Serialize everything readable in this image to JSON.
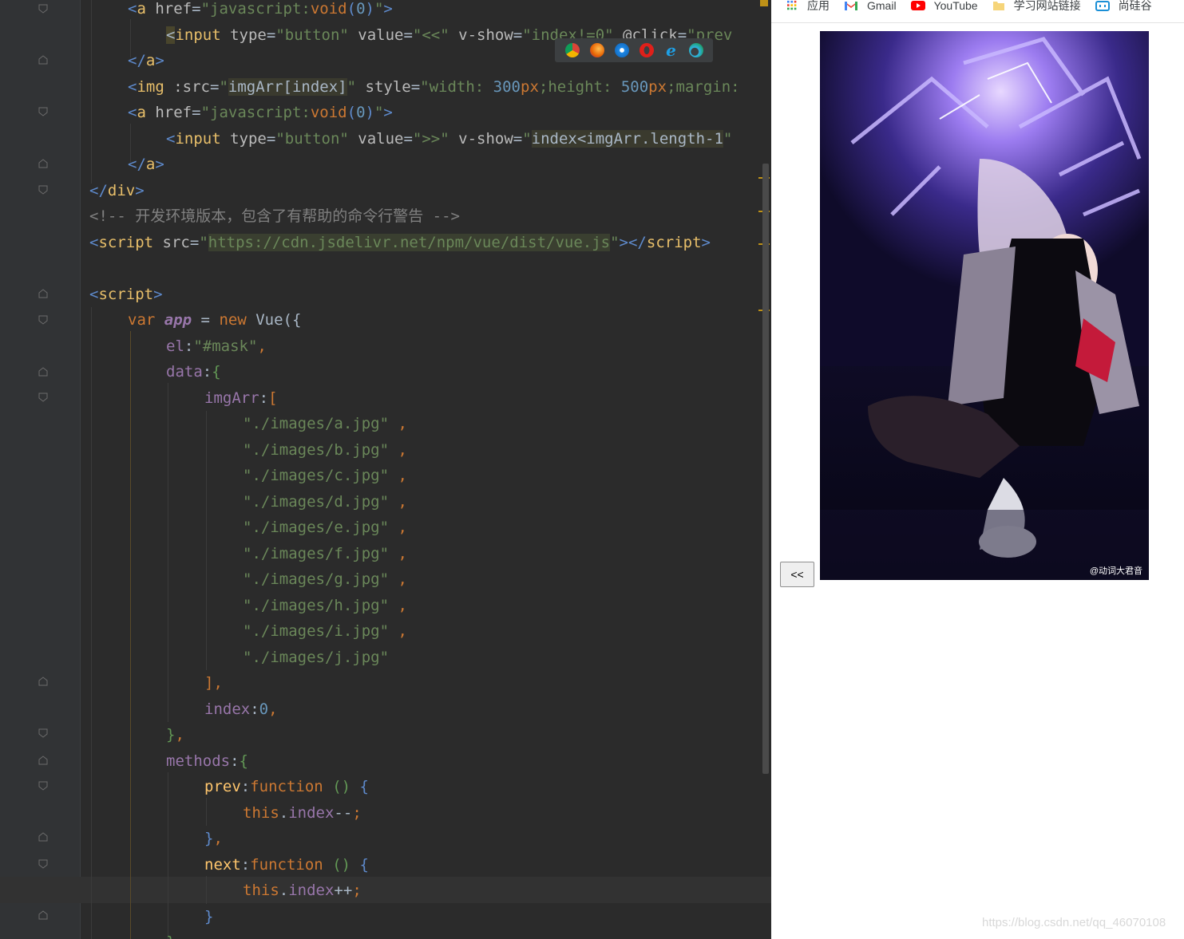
{
  "editor": {
    "lines": [
      {
        "tokens": [
          [
            "brk",
            "<"
          ],
          [
            "tag",
            "a"
          ],
          [
            "attr",
            " href"
          ],
          [
            "plain",
            "="
          ],
          [
            "str",
            "\"javascript:"
          ],
          [
            "kw",
            "void"
          ],
          [
            "brk",
            "("
          ],
          [
            "num",
            "0"
          ],
          [
            "brk",
            ")"
          ],
          [
            "str",
            "\""
          ],
          [
            "brk",
            ">"
          ]
        ]
      },
      {
        "tokens": [
          [
            "hlbg",
            "<"
          ],
          [
            "tag",
            "input"
          ],
          [
            "attr",
            " type"
          ],
          [
            "plain",
            "="
          ],
          [
            "str",
            "\"button\""
          ],
          [
            "attr",
            " value"
          ],
          [
            "plain",
            "="
          ],
          [
            "str",
            "\"<<\""
          ],
          [
            "attr",
            " v-show"
          ],
          [
            "plain",
            "="
          ],
          [
            "str",
            "\"index!=0\""
          ],
          [
            "attr",
            " @click"
          ],
          [
            "plain",
            "="
          ],
          [
            "str",
            "\"prev"
          ]
        ]
      },
      {
        "tokens": [
          [
            "brk",
            "</"
          ],
          [
            "tag",
            "a"
          ],
          [
            "brk",
            ">"
          ]
        ]
      },
      {
        "tokens": [
          [
            "brk",
            "<"
          ],
          [
            "tag",
            "img"
          ],
          [
            "attr",
            " :src"
          ],
          [
            "plain",
            "="
          ],
          [
            "str",
            "\""
          ],
          [
            "js",
            "imgArr[index]"
          ],
          [
            "str",
            "\""
          ],
          [
            "attr",
            " style"
          ],
          [
            "plain",
            "="
          ],
          [
            "str",
            "\"width: "
          ],
          [
            "num",
            "300"
          ],
          [
            "kw",
            "px"
          ],
          [
            "str",
            ";height: "
          ],
          [
            "num",
            "500"
          ],
          [
            "kw",
            "px"
          ],
          [
            "str",
            ";margin:"
          ]
        ]
      },
      {
        "tokens": [
          [
            "brk",
            "<"
          ],
          [
            "tag",
            "a"
          ],
          [
            "attr",
            " href"
          ],
          [
            "plain",
            "="
          ],
          [
            "str",
            "\"javascript:"
          ],
          [
            "kw",
            "void"
          ],
          [
            "brk",
            "("
          ],
          [
            "num",
            "0"
          ],
          [
            "brk",
            ")"
          ],
          [
            "str",
            "\""
          ],
          [
            "brk",
            ">"
          ]
        ]
      },
      {
        "tokens": [
          [
            "brk",
            "<"
          ],
          [
            "tag",
            "input"
          ],
          [
            "attr",
            " type"
          ],
          [
            "plain",
            "="
          ],
          [
            "str",
            "\"button\""
          ],
          [
            "attr",
            " value"
          ],
          [
            "plain",
            "="
          ],
          [
            "str",
            "\">>\""
          ],
          [
            "attr",
            " v-show"
          ],
          [
            "plain",
            "="
          ],
          [
            "str",
            "\""
          ],
          [
            "js",
            "index<imgArr.length-1"
          ],
          [
            "str",
            "\""
          ]
        ]
      },
      {
        "tokens": [
          [
            "brk",
            "</"
          ],
          [
            "tag",
            "a"
          ],
          [
            "brk",
            ">"
          ]
        ]
      },
      {
        "tokens": [
          [
            "brk",
            "</"
          ],
          [
            "tag",
            "div"
          ],
          [
            "brk",
            ">"
          ]
        ]
      },
      {
        "tokens": [
          [
            "cmt",
            "<!-- 开发环境版本，包含了有帮助的命令行警告 -->"
          ]
        ]
      },
      {
        "tokens": [
          [
            "brk",
            "<"
          ],
          [
            "tag",
            "script"
          ],
          [
            "attr",
            " src"
          ],
          [
            "plain",
            "="
          ],
          [
            "str",
            "\""
          ],
          [
            "strhl",
            "https://cdn.jsdelivr.net/npm/vue/dist/vue.js"
          ],
          [
            "str",
            "\""
          ],
          [
            "brk",
            "></"
          ],
          [
            "tag",
            "script"
          ],
          [
            "brk",
            ">"
          ]
        ]
      },
      {
        "tokens": []
      },
      {
        "tokens": [
          [
            "brk",
            "<"
          ],
          [
            "tag",
            "script"
          ],
          [
            "brk",
            ">"
          ]
        ]
      },
      {
        "tokens": [
          [
            "kw",
            "var"
          ],
          [
            "plain",
            " "
          ],
          [
            "ital",
            "app"
          ],
          [
            "plain",
            " = "
          ],
          [
            "kw",
            "new"
          ],
          [
            "plain",
            " Vue({"
          ]
        ]
      },
      {
        "tokens": [
          [
            "fld",
            "el"
          ],
          [
            "plain",
            ":"
          ],
          [
            "str",
            "\"#mask\""
          ],
          [
            "kw",
            ","
          ]
        ]
      },
      {
        "tokens": [
          [
            "fld",
            "data"
          ],
          [
            "plain",
            ":"
          ],
          [
            "green",
            "{"
          ]
        ]
      },
      {
        "tokens": [
          [
            "fld",
            "imgArr"
          ],
          [
            "plain",
            ":"
          ],
          [
            "kw",
            "["
          ]
        ]
      },
      {
        "tokens": [
          [
            "str",
            "\"./images/a.jpg\""
          ],
          [
            "kw",
            " ,"
          ]
        ]
      },
      {
        "tokens": [
          [
            "str",
            "\"./images/b.jpg\""
          ],
          [
            "kw",
            " ,"
          ]
        ]
      },
      {
        "tokens": [
          [
            "str",
            "\"./images/c.jpg\""
          ],
          [
            "kw",
            " ,"
          ]
        ]
      },
      {
        "tokens": [
          [
            "str",
            "\"./images/d.jpg\""
          ],
          [
            "kw",
            " ,"
          ]
        ]
      },
      {
        "tokens": [
          [
            "str",
            "\"./images/e.jpg\""
          ],
          [
            "kw",
            " ,"
          ]
        ]
      },
      {
        "tokens": [
          [
            "str",
            "\"./images/f.jpg\""
          ],
          [
            "kw",
            " ,"
          ]
        ]
      },
      {
        "tokens": [
          [
            "str",
            "\"./images/g.jpg\""
          ],
          [
            "kw",
            " ,"
          ]
        ]
      },
      {
        "tokens": [
          [
            "str",
            "\"./images/h.jpg\""
          ],
          [
            "kw",
            " ,"
          ]
        ]
      },
      {
        "tokens": [
          [
            "str",
            "\"./images/i.jpg\""
          ],
          [
            "kw",
            " ,"
          ]
        ]
      },
      {
        "tokens": [
          [
            "str",
            "\"./images/j.jpg\""
          ]
        ]
      },
      {
        "tokens": [
          [
            "kw",
            "],"
          ]
        ]
      },
      {
        "tokens": [
          [
            "fld",
            "index"
          ],
          [
            "plain",
            ":"
          ],
          [
            "num",
            "0"
          ],
          [
            "kw",
            ","
          ]
        ]
      },
      {
        "tokens": [
          [
            "green",
            "}"
          ],
          [
            "kw",
            ","
          ]
        ]
      },
      {
        "tokens": [
          [
            "fld",
            "methods"
          ],
          [
            "plain",
            ":"
          ],
          [
            "green",
            "{"
          ]
        ]
      },
      {
        "tokens": [
          [
            "fn",
            "prev"
          ],
          [
            "plain",
            ":"
          ],
          [
            "kw",
            "function"
          ],
          [
            "plain",
            " "
          ],
          [
            "green",
            "()"
          ],
          [
            "plain",
            " "
          ],
          [
            "brk",
            "{"
          ]
        ]
      },
      {
        "tokens": [
          [
            "kw",
            "this"
          ],
          [
            "plain",
            "."
          ],
          [
            "fld",
            "index"
          ],
          [
            "plain",
            "--"
          ],
          [
            "kw",
            ";"
          ]
        ]
      },
      {
        "tokens": [
          [
            "brk",
            "}"
          ],
          [
            "kw",
            ","
          ]
        ]
      },
      {
        "tokens": [
          [
            "fn",
            "next"
          ],
          [
            "plain",
            ":"
          ],
          [
            "kw",
            "function"
          ],
          [
            "plain",
            " "
          ],
          [
            "green",
            "()"
          ],
          [
            "plain",
            " "
          ],
          [
            "brk",
            "{"
          ]
        ]
      },
      {
        "tokens": [
          [
            "kw",
            "this"
          ],
          [
            "plain",
            "."
          ],
          [
            "fld",
            "index"
          ],
          [
            "plain",
            "++"
          ],
          [
            "kw",
            ";"
          ]
        ]
      },
      {
        "tokens": [
          [
            "brk",
            "}"
          ]
        ]
      },
      {
        "tokens": [
          [
            "green",
            "}"
          ]
        ]
      }
    ]
  },
  "browser_icons": [
    "chrome-icon",
    "firefox-icon",
    "safari-icon",
    "opera-icon",
    "ie-icon",
    "edge-icon"
  ],
  "bookmarks": {
    "apps": "应用",
    "gmail": "Gmail",
    "youtube": "YouTube",
    "folder": "学习网站链接",
    "more": "尚硅谷"
  },
  "page": {
    "prev_button": "<<",
    "photo_credit": "@动词大君音",
    "watermark": "https://blog.csdn.net/qq_46070108"
  },
  "colors": {
    "editor_bg": "#2b2b2b",
    "gutter_bg": "#313335",
    "browser_bg": "#ffffff"
  }
}
